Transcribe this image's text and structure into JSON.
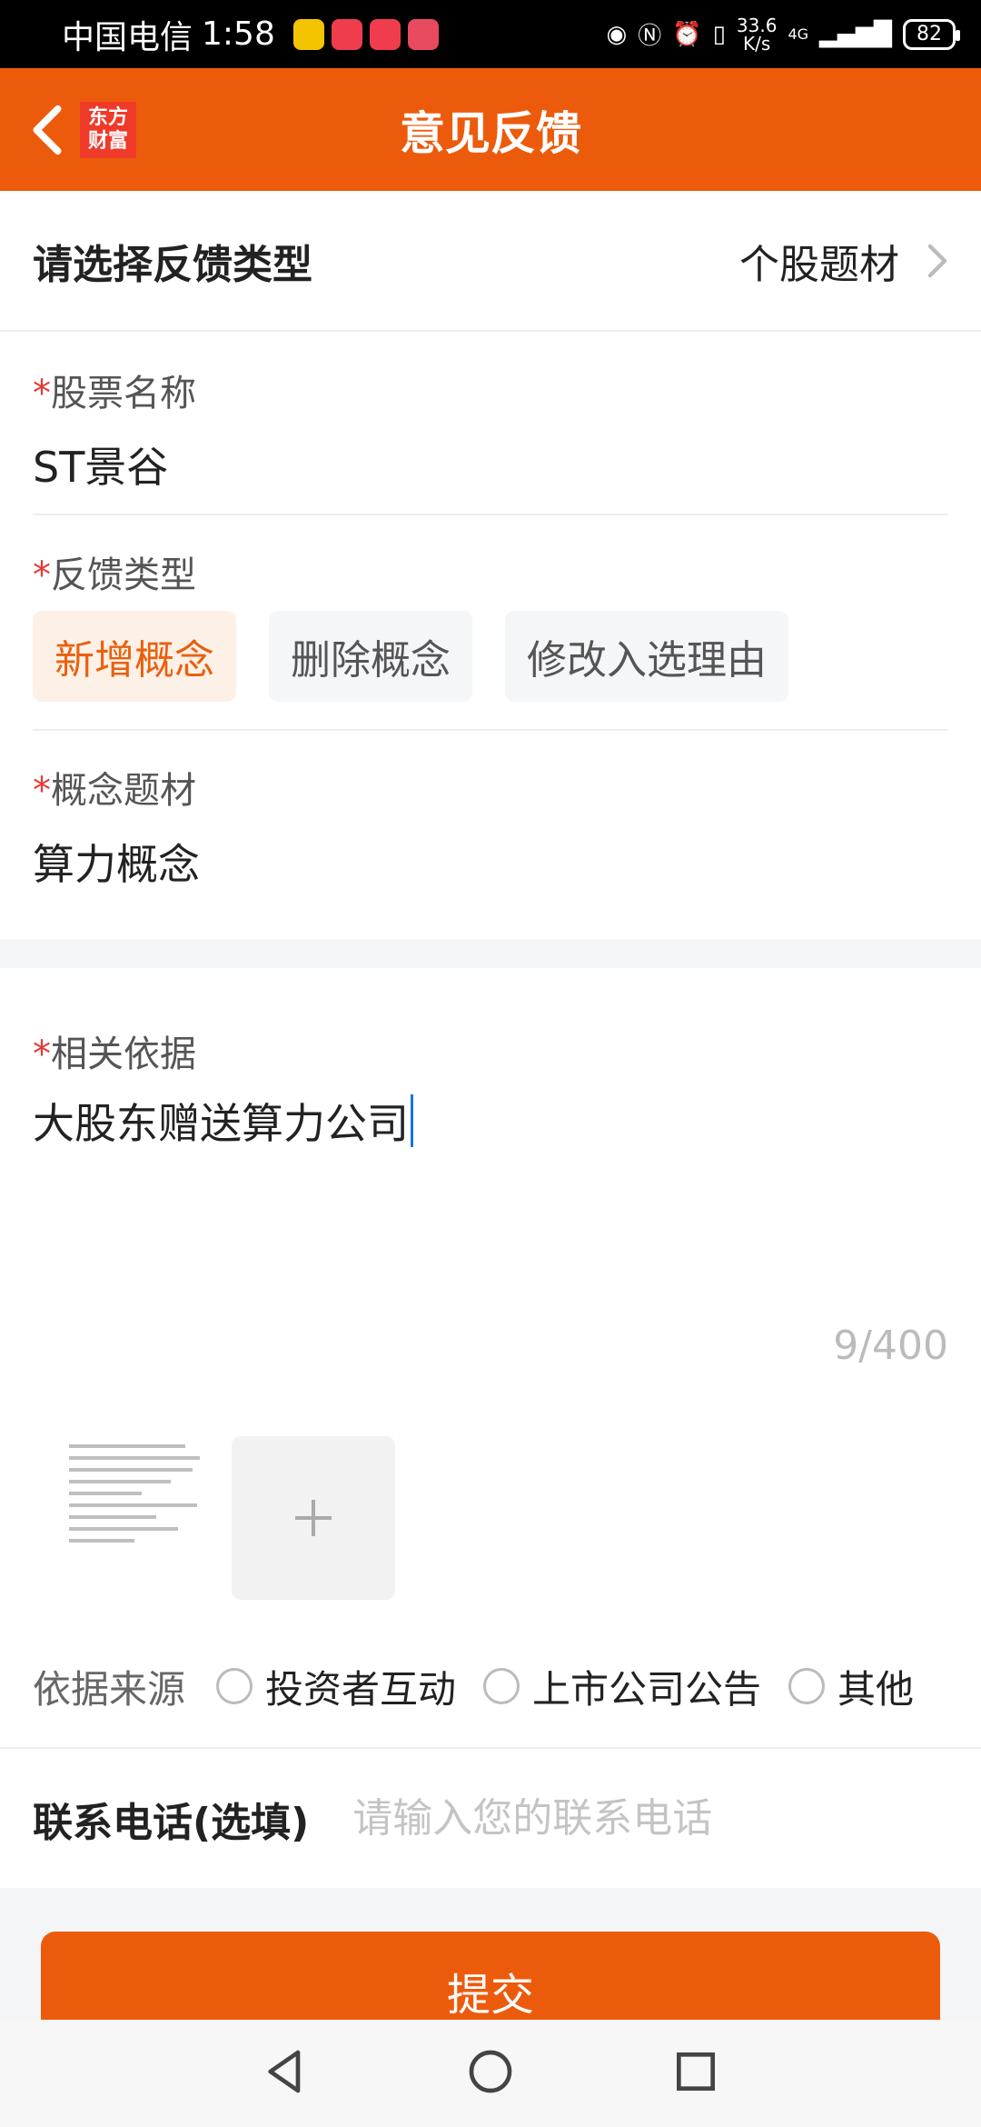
{
  "status_bar": {
    "carrier": "中国电信",
    "time": "1:58",
    "net_speed_value": "33.6",
    "net_speed_unit": "K/s",
    "network_type": "4G",
    "battery": "82"
  },
  "header": {
    "title": "意见反馈",
    "logo_line1": "东方",
    "logo_line2": "财富"
  },
  "feedback_type": {
    "label": "请选择反馈类型",
    "value": "个股题材"
  },
  "stock": {
    "label": "股票名称",
    "value": "ST景谷"
  },
  "feedback_kind": {
    "label": "反馈类型",
    "options": [
      "新增概念",
      "删除概念",
      "修改入选理由"
    ],
    "selected": "新增概念"
  },
  "concept": {
    "label": "概念题材",
    "value": "算力概念"
  },
  "basis": {
    "label": "相关依据",
    "value": "大股东赠送算力公司",
    "counter": "9/400"
  },
  "source": {
    "label": "依据来源",
    "options": [
      "投资者互动",
      "上市公司公告",
      "其他"
    ]
  },
  "contact": {
    "label": "联系电话(选填)",
    "placeholder": "请输入您的联系电话"
  },
  "submit_label": "提交",
  "required_mark": "*",
  "colors": {
    "accent": "#ec5b0c",
    "required": "#e53935",
    "chip_active_bg": "#fdf0e7"
  }
}
